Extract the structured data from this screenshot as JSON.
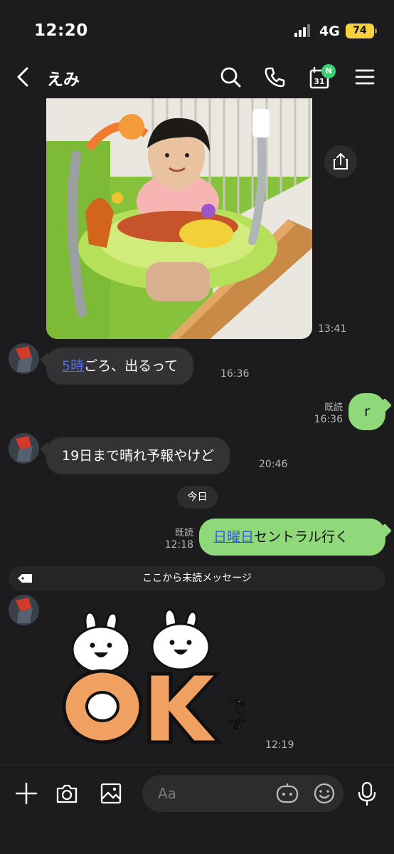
{
  "status_bar": {
    "time": "12:20",
    "network": "4G",
    "battery": "74"
  },
  "header": {
    "title": "えみ",
    "calendar_day": "31",
    "calendar_badge": "N"
  },
  "messages": [
    {
      "type": "image",
      "time": "13:41"
    },
    {
      "type": "text_in",
      "link": "5時",
      "text": "ごろ、出るって",
      "time": "16:36"
    },
    {
      "type": "text_out",
      "text": "r",
      "read": "既読",
      "time": "16:36"
    },
    {
      "type": "text_in",
      "text": "19日まで晴れ予報やけど",
      "time": "20:46"
    },
    {
      "type": "date_divider",
      "text": "今日"
    },
    {
      "type": "text_out",
      "link": "日曜日",
      "text": "セントラル行く",
      "read": "既読",
      "time": "12:18"
    },
    {
      "type": "unread_divider",
      "text": "ここから未読メッセージ"
    },
    {
      "type": "sticker",
      "text_main": "OK",
      "text_side": "です",
      "time": "12:19"
    }
  ],
  "input": {
    "placeholder": "Aa"
  },
  "colors": {
    "background": "#1c1c1e",
    "bubble_out": "#8fd97a",
    "bubble_in": "#333336",
    "link": "#4a6cf7",
    "badge": "#3bd16f",
    "battery": "#f7d23e"
  }
}
